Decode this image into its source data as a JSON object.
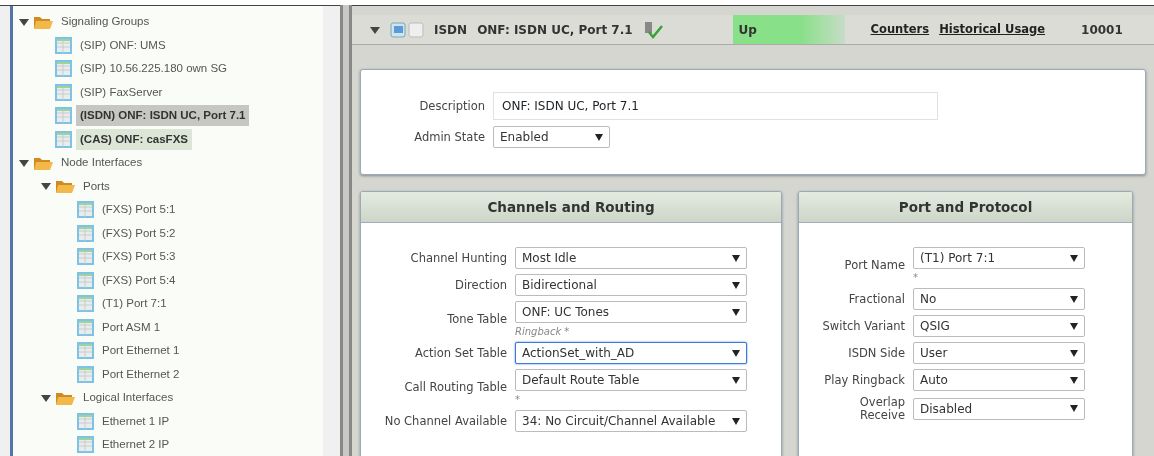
{
  "tree": [
    {
      "label": "Signaling Groups",
      "kind": "folder",
      "expanded": true,
      "children": [
        {
          "label": "(SIP) ONF: UMS",
          "kind": "item",
          "selected": false,
          "highlighted": false
        },
        {
          "label": "(SIP) 10.56.225.180 own SG",
          "kind": "item",
          "selected": false,
          "highlighted": false
        },
        {
          "label": "(SIP) FaxServer",
          "kind": "item",
          "selected": false,
          "highlighted": false
        },
        {
          "label": "(ISDN) ONF: ISDN UC, Port 7.1",
          "kind": "item",
          "selected": true,
          "highlighted": false
        },
        {
          "label": "(CAS) ONF: casFXS",
          "kind": "item",
          "selected": false,
          "highlighted": true
        }
      ]
    },
    {
      "label": "Node Interfaces",
      "kind": "folder",
      "expanded": true,
      "children": [
        {
          "label": "Ports",
          "kind": "folder",
          "expanded": true,
          "children": [
            {
              "label": "(FXS) Port 5:1",
              "kind": "item",
              "selected": false,
              "highlighted": false
            },
            {
              "label": "(FXS) Port 5:2",
              "kind": "item",
              "selected": false,
              "highlighted": false
            },
            {
              "label": "(FXS) Port 5:3",
              "kind": "item",
              "selected": false,
              "highlighted": false
            },
            {
              "label": "(FXS) Port 5:4",
              "kind": "item",
              "selected": false,
              "highlighted": false
            },
            {
              "label": "(T1) Port 7:1",
              "kind": "item",
              "selected": false,
              "highlighted": false
            },
            {
              "label": "Port ASM 1",
              "kind": "item",
              "selected": false,
              "highlighted": false
            },
            {
              "label": "Port Ethernet 1",
              "kind": "item",
              "selected": false,
              "highlighted": false
            },
            {
              "label": "Port Ethernet 2",
              "kind": "item",
              "selected": false,
              "highlighted": false
            }
          ]
        },
        {
          "label": "Logical Interfaces",
          "kind": "folder",
          "expanded": true,
          "children": [
            {
              "label": "Ethernet 1 IP",
              "kind": "item",
              "selected": false,
              "highlighted": false
            },
            {
              "label": "Ethernet 2 IP",
              "kind": "item",
              "selected": false,
              "highlighted": false
            }
          ]
        }
      ]
    }
  ],
  "header": {
    "expanded": true,
    "type": "ISDN",
    "name": "ONF: ISDN UC, Port 7.1",
    "status": "Up",
    "links": [
      "Counters",
      "Historical Usage"
    ],
    "column_5": "10001"
  },
  "general": [
    {
      "label": "Description",
      "kind": "text",
      "value": "ONF: ISDN UC, Port 7.1"
    },
    {
      "label": "Admin State",
      "kind": "select",
      "value": "Enabled"
    }
  ],
  "panels": [
    {
      "title": "Channels and Routing",
      "fields": [
        {
          "label": "Channel Hunting",
          "value": "Most Idle",
          "focused": false
        },
        {
          "label": "Direction",
          "value": "Bidirectional",
          "focused": false
        },
        {
          "label": "Tone Table",
          "value": "ONF: UC Tones",
          "note": "Ringback *",
          "focused": false
        },
        {
          "label": "Action Set Table",
          "value": "ActionSet_with_AD",
          "focused": true
        },
        {
          "label": "Call Routing Table",
          "value": "Default Route Table",
          "note": "*",
          "focused": false
        },
        {
          "label": "No Channel Available",
          "value": "34: No Circuit/Channel Available",
          "focused": false
        }
      ]
    },
    {
      "title": "Port and Protocol",
      "fields": [
        {
          "label": "Port Name",
          "value": "(T1) Port 7:1",
          "note": "*",
          "focused": false
        },
        {
          "label": "Fractional",
          "value": "No",
          "focused": false
        },
        {
          "label": "Switch Variant",
          "value": "QSIG",
          "focused": false
        },
        {
          "label": "ISDN Side",
          "value": "User",
          "focused": false
        },
        {
          "label": "Play Ringback",
          "value": "Auto",
          "focused": false
        },
        {
          "label": "Overlap Receive",
          "value": "Disabled",
          "focused": false
        }
      ]
    }
  ]
}
